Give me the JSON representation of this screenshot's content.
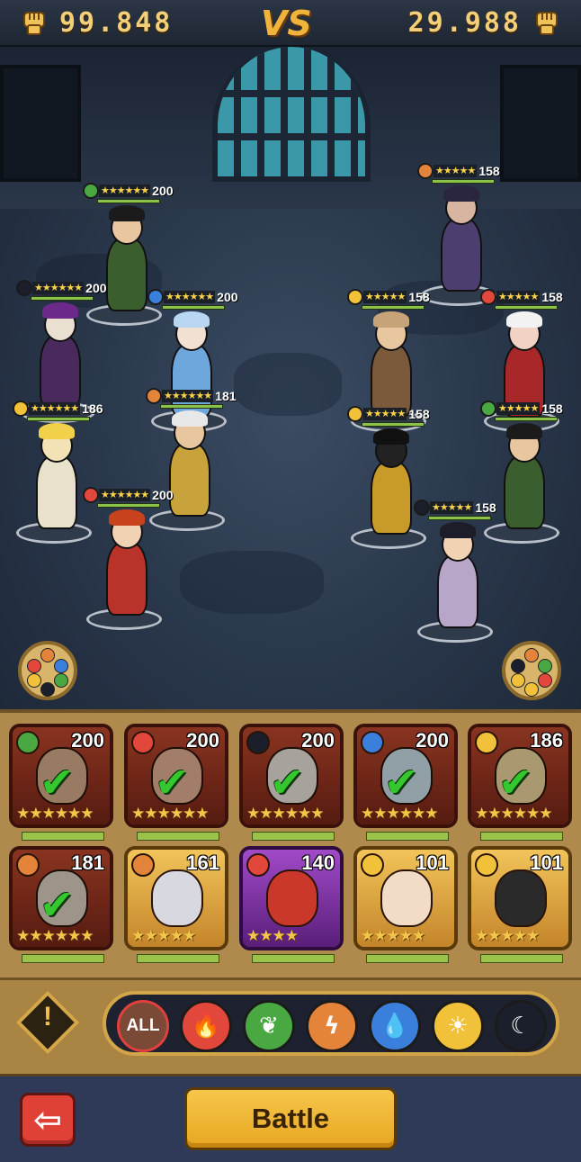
{
  "header": {
    "left_power": "99.848",
    "vs_label": "VS",
    "right_power": "29.988"
  },
  "battlefield": {
    "allies": [
      {
        "name": "sorcerer",
        "element": "nature",
        "stars": "★★★★★★",
        "level": "200"
      },
      {
        "name": "jester",
        "element": "dark",
        "stars": "★★★★★★",
        "level": "200"
      },
      {
        "name": "ice-queen",
        "element": "water",
        "stars": "★★★★★★",
        "level": "200"
      },
      {
        "name": "angel-knight",
        "element": "light",
        "stars": "★★★★★★",
        "level": "186"
      },
      {
        "name": "golden-paladin",
        "element": "lightning",
        "stars": "★★★★★★",
        "level": "181"
      },
      {
        "name": "fire-mage",
        "element": "fire",
        "stars": "★★★★★★",
        "level": "200"
      }
    ],
    "enemies": [
      {
        "name": "gunner",
        "element": "lightning",
        "stars": "★★★★★",
        "level": "158"
      },
      {
        "name": "barbarian",
        "element": "light",
        "stars": "★★★★★",
        "level": "158"
      },
      {
        "name": "crimson-witch",
        "element": "fire",
        "stars": "★★★★★",
        "level": "158"
      },
      {
        "name": "shadow-ninja",
        "element": "light",
        "stars": "★★★★★",
        "level": "158"
      },
      {
        "name": "sorcerer",
        "element": "nature",
        "stars": "★★★★★",
        "level": "158"
      },
      {
        "name": "monk",
        "element": "dark",
        "stars": "★★★★★",
        "level": "158"
      }
    ]
  },
  "roster": [
    {
      "element": "nature",
      "level": "200",
      "stars": "★★★★★★",
      "selected": true,
      "check": "✔",
      "frame": "red"
    },
    {
      "element": "fire",
      "level": "200",
      "stars": "★★★★★★",
      "selected": true,
      "check": "✔",
      "frame": "red"
    },
    {
      "element": "dark",
      "level": "200",
      "stars": "★★★★★★",
      "selected": true,
      "check": "✔",
      "frame": "red"
    },
    {
      "element": "water",
      "level": "200",
      "stars": "★★★★★★",
      "selected": true,
      "check": "✔",
      "frame": "red"
    },
    {
      "element": "light",
      "level": "186",
      "stars": "★★★★★★",
      "selected": true,
      "check": "✔",
      "frame": "red"
    },
    {
      "element": "lightning",
      "level": "181",
      "stars": "★★★★★★",
      "selected": true,
      "check": "✔",
      "frame": "red"
    },
    {
      "element": "lightning",
      "level": "161",
      "stars": "★★★★★",
      "selected": false,
      "check": "",
      "frame": "gold"
    },
    {
      "element": "fire",
      "level": "140",
      "stars": "★★★★",
      "selected": false,
      "check": "",
      "frame": "purple"
    },
    {
      "element": "light",
      "level": "101",
      "stars": "★★★★★",
      "selected": false,
      "check": "",
      "frame": "gold"
    },
    {
      "element": "light",
      "level": "101",
      "stars": "★★★★★",
      "selected": false,
      "check": "",
      "frame": "gold"
    }
  ],
  "filters": {
    "info_symbol": "!",
    "items": [
      {
        "name": "all",
        "label": "ALL"
      },
      {
        "name": "fire",
        "label": "🔥"
      },
      {
        "name": "nature",
        "label": "❦"
      },
      {
        "name": "lightning",
        "label": "ϟ"
      },
      {
        "name": "water",
        "label": "💧"
      },
      {
        "name": "light",
        "label": "☀"
      },
      {
        "name": "dark",
        "label": "☾"
      }
    ]
  },
  "footer": {
    "back_symbol": "⇦",
    "battle_label": "Battle"
  },
  "element_colors": {
    "fire": "#e2473b",
    "nature": "#4aa843",
    "lightning": "#e4843a",
    "water": "#3a7fdc",
    "light": "#f2c13a",
    "dark": "#1b1e2b"
  }
}
